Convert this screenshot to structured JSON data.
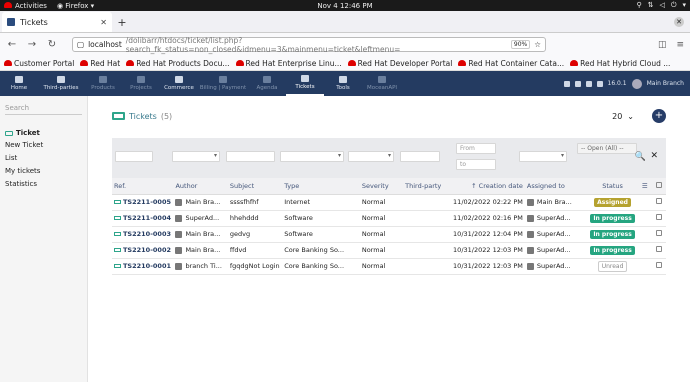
{
  "gnome": {
    "activities": "Activities",
    "app": "Firefox",
    "datetime": "Nov 4  12:46 PM"
  },
  "browser": {
    "tab_title": "Tickets",
    "url_host": "localhost",
    "url_path": "/dolibarr/htdocs/ticket/list.php?search_fk_status=non_closed&idmenu=3&mainmenu=ticket&leftmenu=",
    "zoom": "90%"
  },
  "bookmarks": [
    "Customer Portal",
    "Red Hat",
    "Red Hat Products Docu...",
    "Red Hat Enterprise Linu...",
    "Red Hat Developer Portal",
    "Red Hat Container Cata...",
    "Red Hat Hybrid Cloud ..."
  ],
  "topmenu": [
    {
      "label": "Home",
      "state": "normal"
    },
    {
      "label": "Third-parties",
      "state": "normal"
    },
    {
      "label": "Products",
      "state": "dim"
    },
    {
      "label": "Projects",
      "state": "dim"
    },
    {
      "label": "Commerce",
      "state": "normal"
    },
    {
      "label": "Billing | Payment",
      "state": "dim"
    },
    {
      "label": "Agenda",
      "state": "dim"
    },
    {
      "label": "Tickets",
      "state": "active"
    },
    {
      "label": "Tools",
      "state": "normal"
    },
    {
      "label": "MoceanAPI",
      "state": "dim"
    }
  ],
  "topright": {
    "version": "16.0.1",
    "user": "Main Branch"
  },
  "left": {
    "search_placeholder": "Search",
    "title": "Ticket",
    "links": [
      "New Ticket",
      "List",
      "My tickets",
      "Statistics"
    ]
  },
  "main": {
    "title": "Tickets",
    "count": "(5)",
    "per_page": "20",
    "filter": {
      "from": "From",
      "to": "to",
      "status": "-- Open (All) --"
    },
    "columns": [
      "Ref.",
      "Author",
      "Subject",
      "Type",
      "Severity",
      "Third-party",
      "Creation date",
      "Assigned to",
      "Status"
    ],
    "rows": [
      {
        "ref": "TS2211-0005",
        "author": "Main Bra...",
        "subject": "ssssfhfhf",
        "type": "Internet",
        "severity": "Normal",
        "thirdparty": "",
        "date": "11/02/2022 02:22 PM",
        "assigned": "Main Bra...",
        "status": "Assigned",
        "status_class": "b-assigned"
      },
      {
        "ref": "TS2211-0004",
        "author": "SuperAd...",
        "subject": "hhehddd",
        "type": "Software",
        "severity": "Normal",
        "thirdparty": "",
        "date": "11/02/2022 02:16 PM",
        "assigned": "SuperAd...",
        "status": "In progress",
        "status_class": "b-progress"
      },
      {
        "ref": "TS2210-0003",
        "author": "Main Bra...",
        "subject": "gedvg",
        "type": "Software",
        "severity": "Normal",
        "thirdparty": "",
        "date": "10/31/2022 12:04 PM",
        "assigned": "SuperAd...",
        "status": "In progress",
        "status_class": "b-progress"
      },
      {
        "ref": "TS2210-0002",
        "author": "Main Bra...",
        "subject": "ffdvd",
        "type": "Core Banking So...",
        "severity": "Normal",
        "thirdparty": "",
        "date": "10/31/2022 12:03 PM",
        "assigned": "SuperAd...",
        "status": "In progress",
        "status_class": "b-progress"
      },
      {
        "ref": "TS2210-0001",
        "author": "branch Ti...",
        "subject": "fgqdgNot Login",
        "type": "Core Banking So...",
        "severity": "Normal",
        "thirdparty": "",
        "date": "10/31/2022 12:03 PM",
        "assigned": "SuperAd...",
        "status": "Unread",
        "status_class": "b-unread"
      }
    ]
  }
}
